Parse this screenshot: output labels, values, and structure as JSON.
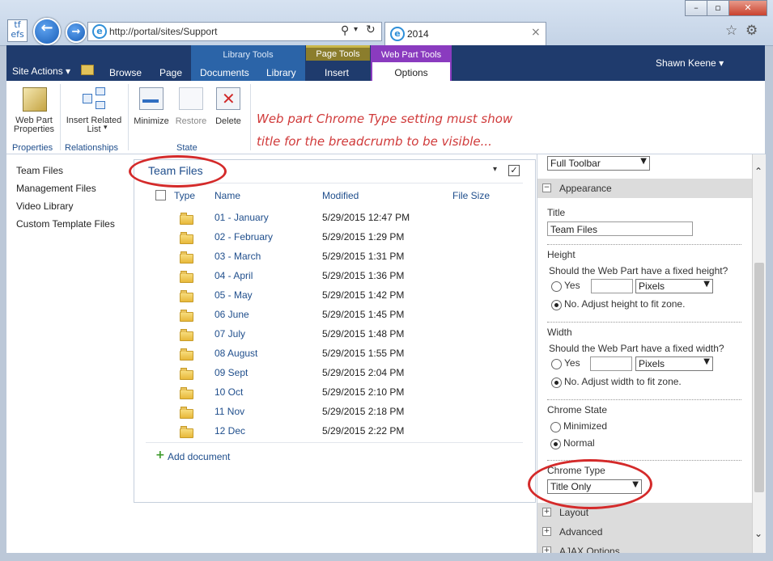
{
  "browser": {
    "logo_text": "tf efs",
    "address_url": "http://portal/sites/Support",
    "tab_title": "2014",
    "tab_close": "×",
    "icons": [
      "back-arrow-icon",
      "forward-arrow-icon",
      "ie-icon",
      "search-icon",
      "refresh-icon",
      "home-star-icon",
      "gear-icon"
    ]
  },
  "ribbon": {
    "site_actions": "Site Actions",
    "tabs": {
      "browse": "Browse",
      "page": "Page",
      "documents": "Documents",
      "library": "Library",
      "insert": "Insert",
      "options": "Options"
    },
    "context_groups": {
      "library_tools": "Library Tools",
      "page_tools": "Page Tools",
      "web_part_tools": "Web Part Tools"
    },
    "user_name": "Shawn Keene",
    "buttons": {
      "web_part_properties": "Web Part Properties",
      "insert_related_list": "Insert Related List",
      "minimize": "Minimize",
      "restore": "Restore",
      "delete": "Delete"
    },
    "groups": {
      "properties": "Properties",
      "relationships": "Relationships",
      "state": "State"
    },
    "colors": {
      "ribbon_bg": "#1f3b6d",
      "library_tools": "#2b64a8",
      "page_tools": "#8b7d2c",
      "web_part_tools": "#8a3bbf"
    }
  },
  "annotation": {
    "line1": "Web part Chrome Type setting must show",
    "line2": "title for the breadcrumb to be visible..."
  },
  "left_nav": {
    "items": [
      "Team Files",
      "Management Files",
      "Video Library",
      "Custom Template Files"
    ]
  },
  "webpart": {
    "title": "Team Files",
    "columns": {
      "type": "Type",
      "name": "Name",
      "modified": "Modified",
      "size": "File Size"
    },
    "rows": [
      {
        "name": "01 - January",
        "modified": "5/29/2015 12:47 PM"
      },
      {
        "name": "02 - February",
        "modified": "5/29/2015 1:29 PM"
      },
      {
        "name": "03 - March",
        "modified": "5/29/2015 1:31 PM"
      },
      {
        "name": "04 - April",
        "modified": "5/29/2015 1:36 PM"
      },
      {
        "name": "05 - May",
        "modified": "5/29/2015 1:42 PM"
      },
      {
        "name": "06 June",
        "modified": "5/29/2015 1:45 PM"
      },
      {
        "name": "07 July",
        "modified": "5/29/2015 1:48 PM"
      },
      {
        "name": "08 August",
        "modified": "5/29/2015 1:55 PM"
      },
      {
        "name": "09 Sept",
        "modified": "5/29/2015 2:04 PM"
      },
      {
        "name": "10 Oct",
        "modified": "5/29/2015 2:10 PM"
      },
      {
        "name": "11 Nov",
        "modified": "5/29/2015 2:18 PM"
      },
      {
        "name": "12 Dec",
        "modified": "5/29/2015 2:22 PM"
      }
    ],
    "add_document": "Add document"
  },
  "toolpane": {
    "toolbar_select": "Full Toolbar",
    "appearance": "Appearance",
    "title_label": "Title",
    "title_value": "Team Files",
    "height_label": "Height",
    "height_question": "Should the Web Part have a fixed height?",
    "width_label": "Width",
    "width_question": "Should the Web Part have a fixed width?",
    "yes": "Yes",
    "pixels": "Pixels",
    "no_height": "No. Adjust height to fit zone.",
    "no_width": "No. Adjust width to fit zone.",
    "chrome_state_label": "Chrome State",
    "minimized": "Minimized",
    "normal": "Normal",
    "chrome_type_label": "Chrome Type",
    "chrome_type_value": "Title Only",
    "layout": "Layout",
    "advanced": "Advanced",
    "ajax": "AJAX Options"
  }
}
